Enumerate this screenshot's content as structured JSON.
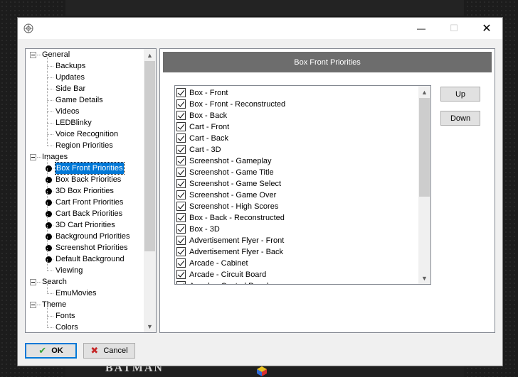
{
  "window": {
    "close_glyph": "✕",
    "maximize_glyph": "☐",
    "minimize_glyph": "—"
  },
  "tree": {
    "items": [
      {
        "label": "General",
        "level": 0,
        "expanded": true
      },
      {
        "label": "Backups",
        "level": 1
      },
      {
        "label": "Updates",
        "level": 1
      },
      {
        "label": "Side Bar",
        "level": 1
      },
      {
        "label": "Game Details",
        "level": 1
      },
      {
        "label": "Videos",
        "level": 1
      },
      {
        "label": "LEDBlinky",
        "level": 1
      },
      {
        "label": "Voice Recognition",
        "level": 1
      },
      {
        "label": "Region Priorities",
        "level": 1
      },
      {
        "label": "Images",
        "level": 0,
        "expanded": true
      },
      {
        "label": "Box Front Priorities",
        "level": 1,
        "selected": true
      },
      {
        "label": "Box Back Priorities",
        "level": 1
      },
      {
        "label": "3D Box Priorities",
        "level": 1
      },
      {
        "label": "Cart Front Priorities",
        "level": 1
      },
      {
        "label": "Cart Back Priorities",
        "level": 1
      },
      {
        "label": "3D Cart Priorities",
        "level": 1
      },
      {
        "label": "Background Priorities",
        "level": 1
      },
      {
        "label": "Screenshot Priorities",
        "level": 1
      },
      {
        "label": "Default Background",
        "level": 1
      },
      {
        "label": "Viewing",
        "level": 1
      },
      {
        "label": "Search",
        "level": 0,
        "expanded": true
      },
      {
        "label": "EmuMovies",
        "level": 1
      },
      {
        "label": "Theme",
        "level": 0,
        "expanded": true
      },
      {
        "label": "Fonts",
        "level": 1
      },
      {
        "label": "Colors",
        "level": 1
      }
    ]
  },
  "panel": {
    "header": "Box Front Priorities"
  },
  "priorities": {
    "items": [
      {
        "label": "Box - Front",
        "checked": true
      },
      {
        "label": "Box - Front - Reconstructed",
        "checked": true
      },
      {
        "label": "Box - Back",
        "checked": true
      },
      {
        "label": "Cart - Front",
        "checked": true
      },
      {
        "label": "Cart - Back",
        "checked": true
      },
      {
        "label": "Cart - 3D",
        "checked": true
      },
      {
        "label": "Screenshot - Gameplay",
        "checked": true
      },
      {
        "label": "Screenshot - Game Title",
        "checked": true
      },
      {
        "label": "Screenshot - Game Select",
        "checked": true
      },
      {
        "label": "Screenshot - Game Over",
        "checked": true
      },
      {
        "label": "Screenshot - High Scores",
        "checked": true
      },
      {
        "label": "Box - Back - Reconstructed",
        "checked": true
      },
      {
        "label": "Box - 3D",
        "checked": true
      },
      {
        "label": "Advertisement Flyer - Front",
        "checked": true
      },
      {
        "label": "Advertisement Flyer - Back",
        "checked": true
      },
      {
        "label": "Arcade - Cabinet",
        "checked": true
      },
      {
        "label": "Arcade - Circuit Board",
        "checked": true
      },
      {
        "label": "Arcade - Control Panel",
        "checked": true
      }
    ]
  },
  "buttons": {
    "up": "Up",
    "down": "Down",
    "ok": "OK",
    "cancel": "Cancel"
  },
  "background": {
    "logo_text": "BATMAN"
  },
  "colors": {
    "selection": "#0078d7",
    "header_bar": "#6d6d6d",
    "ok_icon": "#3aa33a",
    "cancel_icon": "#c62828"
  }
}
